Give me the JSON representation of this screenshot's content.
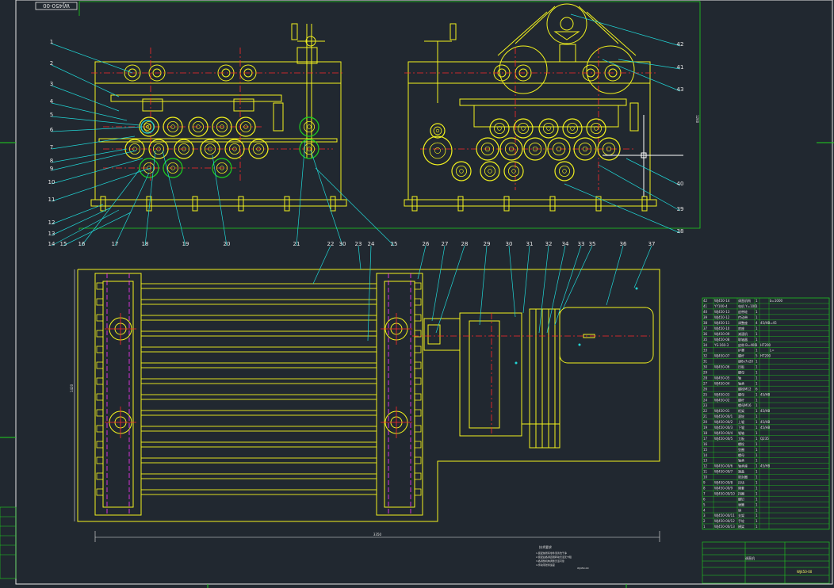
{
  "drawing": {
    "top_stamp": "WJ450-00",
    "title_block_code": "WJ450-00",
    "title_block_name": "调直机",
    "notes_title": "技术要求",
    "notes_lines": [
      "1.装配前所有零件须清洗干净",
      "2.装配后各调直辊转动灵活无卡阻",
      "3.各调整机构调整灵活可靠",
      "4.传动带张紧适度"
    ],
    "notes_tag": "WJ450-00",
    "dim_overall_width": "3350",
    "dim_overall_height": "1420",
    "dim_side_height": "1260"
  },
  "balloons_left": [
    "1",
    "2",
    "3",
    "4",
    "5",
    "6",
    "7",
    "8",
    "9",
    "10",
    "11",
    "12",
    "13",
    "14",
    "15",
    "16",
    "17",
    "18",
    "19",
    "20",
    "21"
  ],
  "balloons_top": [
    "30",
    "23",
    "24",
    "25"
  ],
  "balloons_right": [
    "42",
    "41",
    "43",
    "40",
    "39",
    "38"
  ],
  "balloons_plan": [
    "22",
    "26",
    "27",
    "28",
    "29",
    "30",
    "31",
    "32",
    "34",
    "33",
    "35",
    "36",
    "37"
  ],
  "bom_rows": [
    [
      "42",
      "WJ450-14",
      "调直机构",
      "1",
      "",
      "b=1000"
    ],
    [
      "41",
      "YY100-4",
      "电机 Y=100",
      "1",
      "",
      ""
    ],
    [
      "40",
      "WJ450-13",
      "皮带轮",
      "1",
      "",
      ""
    ],
    [
      "39",
      "WJ450-12",
      "传动带",
      "1",
      "",
      ""
    ],
    [
      "38",
      "WJ450-11",
      "调整座",
      "4",
      "45/HB=45",
      ""
    ],
    [
      "37",
      "WJ450-10",
      "底座",
      "1",
      "",
      ""
    ],
    [
      "36",
      "WJ450-09",
      "减速机",
      "1",
      "",
      ""
    ],
    [
      "35",
      "WJ450-08",
      "联轴器",
      "1",
      "",
      ""
    ],
    [
      "34",
      "YS-160-3",
      "皮带 B=400",
      "1",
      "HT200",
      ""
    ],
    [
      "33",
      "",
      "护罩",
      "1",
      "",
      "L="
    ],
    [
      "32",
      "WJ450-07",
      "螺杆",
      "5",
      "HT200",
      ""
    ],
    [
      "31",
      "",
      "键8x7x20",
      "1",
      "",
      ""
    ],
    [
      "30",
      "WJ450-06",
      "压板",
      "1",
      "",
      ""
    ],
    [
      "29",
      "",
      "螺母",
      "1",
      "",
      ""
    ],
    [
      "28",
      "WJ450-05",
      "轴",
      "1",
      "",
      ""
    ],
    [
      "27",
      "WJ450-04",
      "轴承",
      "1",
      "",
      ""
    ],
    [
      "26",
      "",
      "螺栓M12",
      "6",
      "",
      ""
    ],
    [
      "25",
      "WJ450-03",
      "螺母",
      "1",
      "45/HB",
      ""
    ],
    [
      "24",
      "WJ450-02",
      "螺杆",
      "1",
      "",
      ""
    ],
    [
      "23",
      "",
      "螺母M16",
      "1",
      "",
      ""
    ],
    [
      "22",
      "WJ450-01",
      "框架",
      "1",
      "45/HB",
      ""
    ],
    [
      "21",
      "WJ450-00/1",
      "滚轮",
      "1",
      "",
      ""
    ],
    [
      "20",
      "WJ450-00/2",
      "上辊",
      "1",
      "45/HB",
      ""
    ],
    [
      "19",
      "WJ450-00/3",
      "下辊",
      "1",
      "45/HB",
      ""
    ],
    [
      "18",
      "WJ450-00/4",
      "辊轴",
      "1",
      "",
      ""
    ],
    [
      "17",
      "WJ450-00/5",
      "立板",
      "1",
      "Q235",
      ""
    ],
    [
      "16",
      "",
      "螺栓",
      "1",
      "",
      ""
    ],
    [
      "15",
      "",
      "垫圈",
      "1",
      "",
      ""
    ],
    [
      "14",
      "",
      "螺母",
      "1",
      "",
      ""
    ],
    [
      "13",
      "",
      "轴承",
      "1",
      "",
      ""
    ],
    [
      "12",
      "WJ450-00/6",
      "轴承座",
      "1",
      "45/HB",
      ""
    ],
    [
      "11",
      "WJ450-00/7",
      "端盖",
      "1",
      "",
      ""
    ],
    [
      "10",
      "",
      "密封圈",
      "1",
      "",
      ""
    ],
    [
      "9",
      "WJ450-00/8",
      "压块",
      "1",
      "",
      ""
    ],
    [
      "8",
      "WJ450-00/9",
      "隔套",
      "1",
      "",
      ""
    ],
    [
      "7",
      "WJ450-00/10",
      "挡圈",
      "1",
      "",
      ""
    ],
    [
      "6",
      "",
      "螺钉",
      "1",
      "",
      ""
    ],
    [
      "5",
      "",
      "弹簧",
      "1",
      "",
      ""
    ],
    [
      "4",
      "",
      "销",
      "1",
      "",
      ""
    ],
    [
      "3",
      "WJ450-00/11",
      "支架",
      "1",
      "",
      ""
    ],
    [
      "2",
      "WJ450-00/12",
      "手轮",
      "1",
      "",
      ""
    ],
    [
      "1",
      "WJ450-00/13",
      "横梁",
      "1",
      "",
      ""
    ]
  ],
  "colors": {
    "background": "#212830",
    "yellow": "#f2f21e",
    "green": "#1ed41e",
    "red": "#ff2a2a",
    "cyan": "#21d6d6",
    "magenta": "#ff38ff",
    "white": "#e6e6e6"
  }
}
